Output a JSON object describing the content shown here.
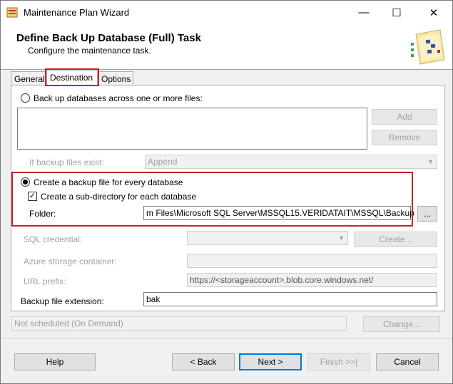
{
  "window": {
    "title": "Maintenance Plan Wizard",
    "minimize": "—",
    "maximize": "☐",
    "close": "✕"
  },
  "header": {
    "title": "Define Back Up Database (Full) Task",
    "subtitle": "Configure the maintenance task."
  },
  "tabs": [
    {
      "label": "General",
      "selected": false
    },
    {
      "label": "Destination",
      "selected": true
    },
    {
      "label": "Options",
      "selected": false
    }
  ],
  "destination": {
    "across_files_label": "Back up databases across one or more files:",
    "add_label": "Add",
    "remove_label": "Remove",
    "if_exist_label": "If backup files exist:",
    "if_exist_value": "Append",
    "every_db_label": "Create a backup file for every database",
    "subdir_label": "Create a sub-directory for each database",
    "subdir_checked": true,
    "folder_label": "Folder:",
    "folder_value": "m Files\\Microsoft SQL Server\\MSSQL15.VERIDATAIT\\MSSQL\\Backup",
    "browse_label": "...",
    "sql_credential_label": "SQL credential:",
    "create_label": "Create...",
    "azure_label": "Azure storage container:",
    "url_prefix_label": "URL prefix:",
    "url_prefix_value": "https://<storageaccount>.blob.core.windows.net/",
    "extension_label": "Backup file extension:",
    "extension_value": "bak"
  },
  "schedule": {
    "text": "Not scheduled (On Demand)",
    "change_label": "Change..."
  },
  "footer": {
    "help": "Help",
    "back": "< Back",
    "next": "Next >",
    "finish": "Finish >>|",
    "cancel": "Cancel"
  }
}
